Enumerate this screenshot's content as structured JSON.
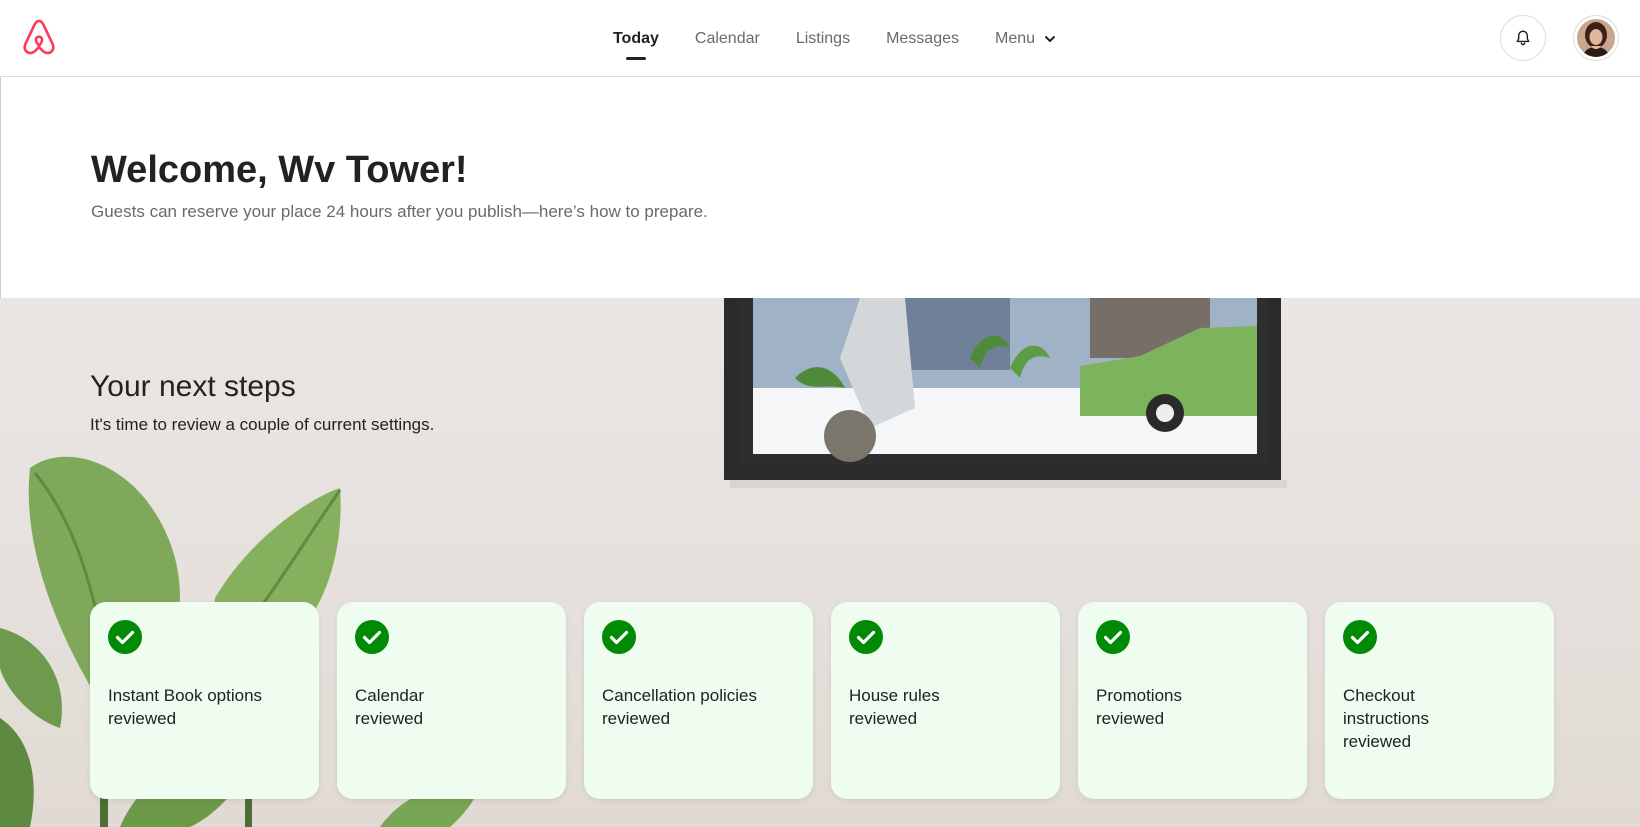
{
  "nav": {
    "items": [
      {
        "label": "Today"
      },
      {
        "label": "Calendar"
      },
      {
        "label": "Listings"
      },
      {
        "label": "Messages"
      },
      {
        "label": "Menu"
      }
    ]
  },
  "welcome": {
    "title": "Welcome, Wv Tower!",
    "subtitle": "Guests can reserve your place 24 hours after you publish—here’s how to prepare."
  },
  "next_steps": {
    "title": "Your next steps",
    "subtitle": "It's time to review a couple of current settings."
  },
  "cards": [
    {
      "label": "Instant Book options reviewed"
    },
    {
      "label": "Calendar reviewed"
    },
    {
      "label": "Cancellation policies reviewed"
    },
    {
      "label": "House rules reviewed"
    },
    {
      "label": "Promotions reviewed"
    },
    {
      "label": "Checkout instructions reviewed"
    }
  ],
  "icons": {
    "logo": "airbnb-logo-icon",
    "bell": "bell-icon",
    "chevron": "chevron-down-icon",
    "check": "check-circle-icon"
  },
  "colors": {
    "brand": "#FF385C",
    "check": "#008A05",
    "card_bg": "#EFFCF0"
  }
}
